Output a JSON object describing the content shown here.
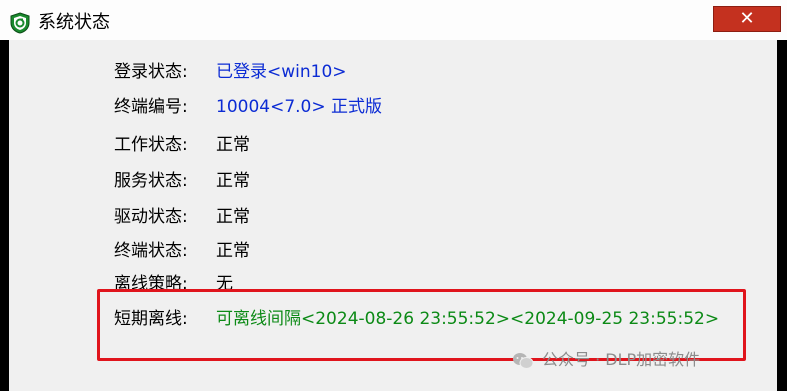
{
  "window": {
    "title": "系统状态",
    "close_symbol": "✕"
  },
  "status_rows": [
    {
      "label": "登录状态:",
      "value": "已登录<win10>",
      "color": "#0b2bd4"
    },
    {
      "label": "终端编号:",
      "value": "10004<7.0> 正式版",
      "color": "#0b2bd4"
    },
    {
      "label": "工作状态:",
      "value": "正常",
      "color": "#000000"
    },
    {
      "label": "服务状态:",
      "value": "正常",
      "color": "#000000"
    },
    {
      "label": "驱动状态:",
      "value": "正常",
      "color": "#000000"
    },
    {
      "label": "终端状态:",
      "value": "正常",
      "color": "#000000"
    },
    {
      "label": "离线策略:",
      "value": "无",
      "color": "#000000"
    },
    {
      "label": "短期离线:",
      "value": "可离线间隔<2024-08-26 23:55:52><2024-09-25 23:55:52>",
      "color": "#0c8a16"
    }
  ],
  "watermark": {
    "text": "公众号 · DLP加密软件",
    "icon": "wechat-icon"
  },
  "colors": {
    "highlight_border": "#e0141c",
    "close_button": "#c4311f"
  }
}
